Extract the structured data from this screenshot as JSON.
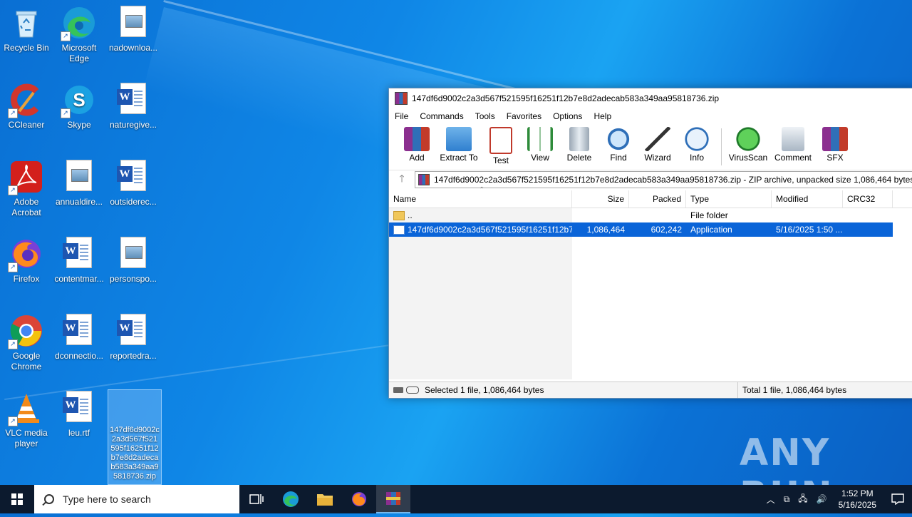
{
  "desktop": {
    "icons": [
      {
        "label": "Recycle Bin"
      },
      {
        "label": "Microsoft Edge"
      },
      {
        "label": "nadownloa..."
      },
      {
        "label": "CCleaner"
      },
      {
        "label": "Skype"
      },
      {
        "label": "naturegive..."
      },
      {
        "label": "Adobe Acrobat"
      },
      {
        "label": "annualdire..."
      },
      {
        "label": "outsiderec..."
      },
      {
        "label": "Firefox"
      },
      {
        "label": "contentmar..."
      },
      {
        "label": "personspo..."
      },
      {
        "label": "Google Chrome"
      },
      {
        "label": "dconnectio..."
      },
      {
        "label": "reportedra..."
      },
      {
        "label": "VLC media player"
      },
      {
        "label": "leu.rtf"
      },
      {
        "label": "147df6d9002c2a3d567f521595f16251f12b7e8d2adecab583a349aa95818736.zip"
      }
    ]
  },
  "winrar": {
    "title": "147df6d9002c2a3d567f521595f16251f12b7e8d2adecab583a349aa95818736.zip",
    "menu": [
      "File",
      "Commands",
      "Tools",
      "Favorites",
      "Options",
      "Help"
    ],
    "toolbar": [
      "Add",
      "Extract To",
      "Test",
      "View",
      "Delete",
      "Find",
      "Wizard",
      "Info",
      "VirusScan",
      "Comment",
      "SFX"
    ],
    "address": "147df6d9002c2a3d567f521595f16251f12b7e8d2adecab583a349aa95818736.zip - ZIP archive, unpacked size 1,086,464 bytes",
    "columns": [
      "Name",
      "Size",
      "Packed",
      "Type",
      "Modified",
      "CRC32"
    ],
    "rows": [
      {
        "name": "..",
        "size": "",
        "packed": "",
        "type": "File folder",
        "modified": ""
      },
      {
        "name": "147df6d9002c2a3d567f521595f16251f12b7...",
        "size": "1,086,464",
        "packed": "602,242",
        "type": "Application",
        "modified": "5/16/2025 1:50 ..."
      }
    ],
    "status_left": "Selected 1 file, 1,086,464 bytes",
    "status_right": "Total 1 file, 1,086,464 bytes"
  },
  "watermark": "ANY RUN",
  "taskbar": {
    "search_placeholder": "Type here to search",
    "time": "1:52 PM",
    "date": "5/16/2025"
  }
}
